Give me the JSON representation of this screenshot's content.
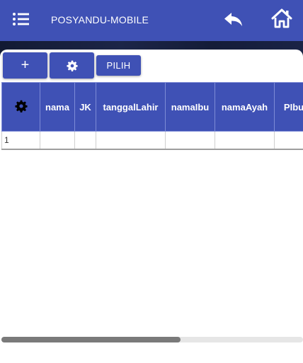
{
  "appbar": {
    "title": "POSYANDU-MOBILE",
    "icons": {
      "menu": "menu-icon",
      "back": "reply-icon",
      "home": "home-icon"
    },
    "color": "#3f51b5"
  },
  "toolbar": {
    "add_label": "+",
    "settings_icon": "gear-icon",
    "pilih_label": "PILIH"
  },
  "table": {
    "header_icon": "gear-icon",
    "columns": [
      "nama",
      "JK",
      "tanggalLahir",
      "namaIbu",
      "namaAyah",
      "PIbu"
    ],
    "rows": [
      {
        "no": "1",
        "cells": [
          "",
          "",
          "",
          "",
          "",
          ""
        ]
      }
    ]
  },
  "scrollbar": {
    "position": 0.0,
    "visible_fraction": 0.6
  }
}
